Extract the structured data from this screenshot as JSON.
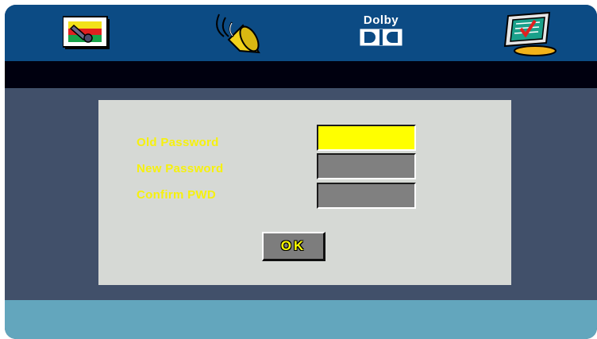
{
  "menu": {
    "tabs": [
      {
        "name": "picture-settings",
        "icon": "tv-picture-icon"
      },
      {
        "name": "audio-settings",
        "icon": "speaker-icon"
      },
      {
        "name": "dolby-settings",
        "icon": "dolby-logo-icon",
        "label": "Dolby"
      },
      {
        "name": "preferences",
        "icon": "checklist-monitor-icon"
      }
    ]
  },
  "dialog": {
    "fields": [
      {
        "label": "Old Password",
        "value": "",
        "active": true
      },
      {
        "label": "New Password",
        "value": "",
        "active": false
      },
      {
        "label": "Confirm PWD",
        "value": "",
        "active": false
      }
    ],
    "ok_label": "OK"
  },
  "colors": {
    "top_bar": "#0c4b84",
    "background": "#41506a",
    "panel": "#d6d9d5",
    "label_text": "#f6f10d",
    "active_field": "#ffff00",
    "inactive_field": "#808080",
    "bottom_bar": "#63a6bd"
  }
}
